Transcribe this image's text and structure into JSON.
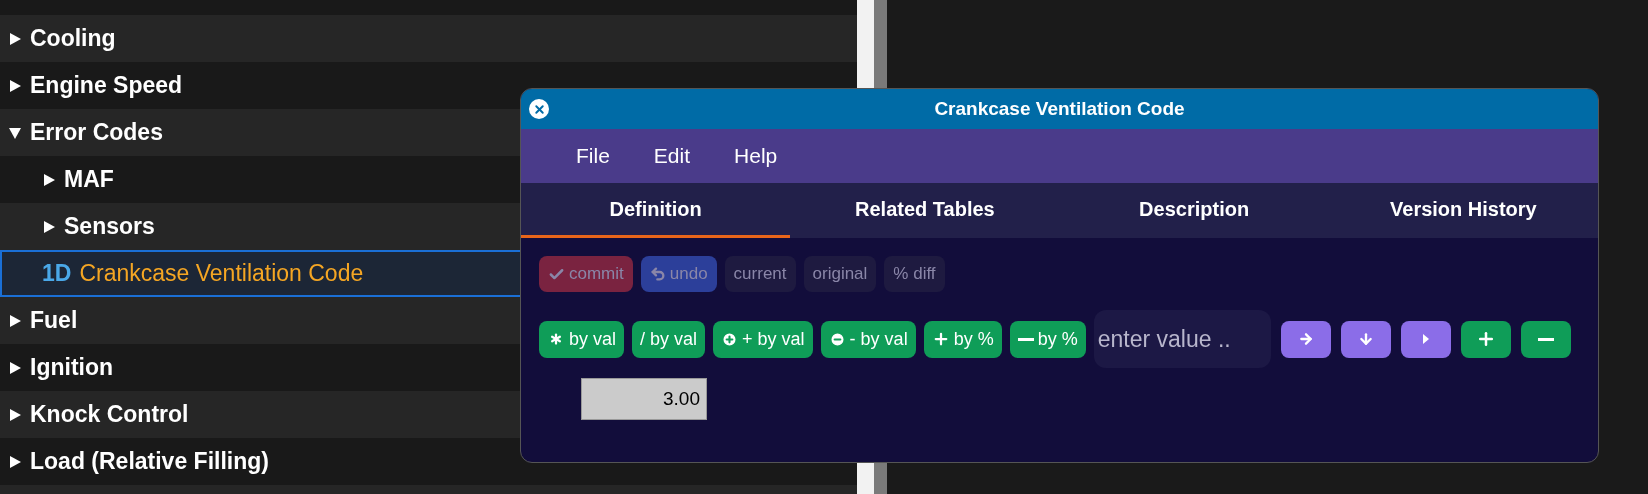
{
  "tree": [
    {
      "label": "Cooling",
      "expanded": false,
      "selected": false
    },
    {
      "label": "Engine Speed",
      "expanded": false,
      "selected": false
    },
    {
      "label": "Error Codes",
      "expanded": true,
      "selected": false,
      "children": [
        {
          "label": "MAF",
          "expanded": false,
          "selected": false
        },
        {
          "label": "Sensors",
          "expanded": false,
          "selected": false
        },
        {
          "label": "Crankcase Ventilation Code",
          "kind": "table",
          "badge": "1D",
          "selected": true
        }
      ]
    },
    {
      "label": "Fuel",
      "expanded": false,
      "selected": false
    },
    {
      "label": "Ignition",
      "expanded": false,
      "selected": false
    },
    {
      "label": "Knock Control",
      "expanded": false,
      "selected": false
    },
    {
      "label": "Load (Relative Filling)",
      "expanded": false,
      "selected": false
    }
  ],
  "dialog": {
    "title": "Crankcase Ventilation Code",
    "menu": [
      "File",
      "Edit",
      "Help"
    ],
    "tabs": [
      {
        "label": "Definition",
        "selected": true
      },
      {
        "label": "Related Tables",
        "selected": false
      },
      {
        "label": "Description",
        "selected": false
      },
      {
        "label": "Version History",
        "selected": false
      }
    ],
    "actions": [
      {
        "label": "commit",
        "kind": "commit",
        "disabled": true
      },
      {
        "label": "undo",
        "kind": "undo",
        "disabled": true
      },
      {
        "label": "current",
        "kind": "plain",
        "disabled": true
      },
      {
        "label": "original",
        "kind": "plain",
        "disabled": true
      },
      {
        "label": "% diff",
        "kind": "plain",
        "disabled": true
      }
    ],
    "operations": [
      {
        "label": "by val",
        "kind": "asterisk"
      },
      {
        "label": "/ by val",
        "kind": "none"
      },
      {
        "label": "+ by val",
        "kind": "plus-circle"
      },
      {
        "label": "- by val",
        "kind": "minus-circle"
      },
      {
        "label": "by %",
        "kind": "plus"
      },
      {
        "label": "by %",
        "kind": "minus"
      }
    ],
    "value_field": {
      "placeholder": "enter value .."
    },
    "tools": [
      {
        "kind": "arrow-right"
      },
      {
        "kind": "arrow-down"
      },
      {
        "kind": "caret-right"
      },
      {
        "kind": "plus"
      },
      {
        "kind": "minus"
      }
    ],
    "cell": {
      "value": "3.00"
    }
  }
}
